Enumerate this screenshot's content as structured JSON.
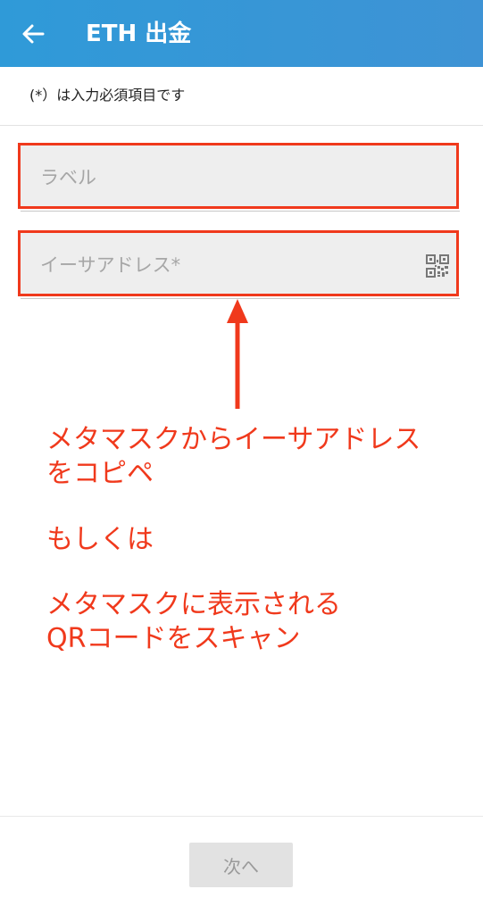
{
  "header": {
    "title": "ETH 出金",
    "bar_color": "#3196d6"
  },
  "form": {
    "required_note": "(*）は入力必須項目です",
    "label_field": {
      "placeholder": "ラベル",
      "value": ""
    },
    "address_field": {
      "placeholder": "イーサアドレス*",
      "value": "",
      "trailing_icon": "qr-code-icon"
    }
  },
  "annotation": {
    "color": "#f0391c",
    "lines": [
      "メタマスクからイーサアドレス",
      "をコピペ",
      "もしくは",
      "メタマスクに表示される",
      "QRコードをスキャン"
    ]
  },
  "footer": {
    "next_label": "次へ",
    "next_enabled": false
  }
}
